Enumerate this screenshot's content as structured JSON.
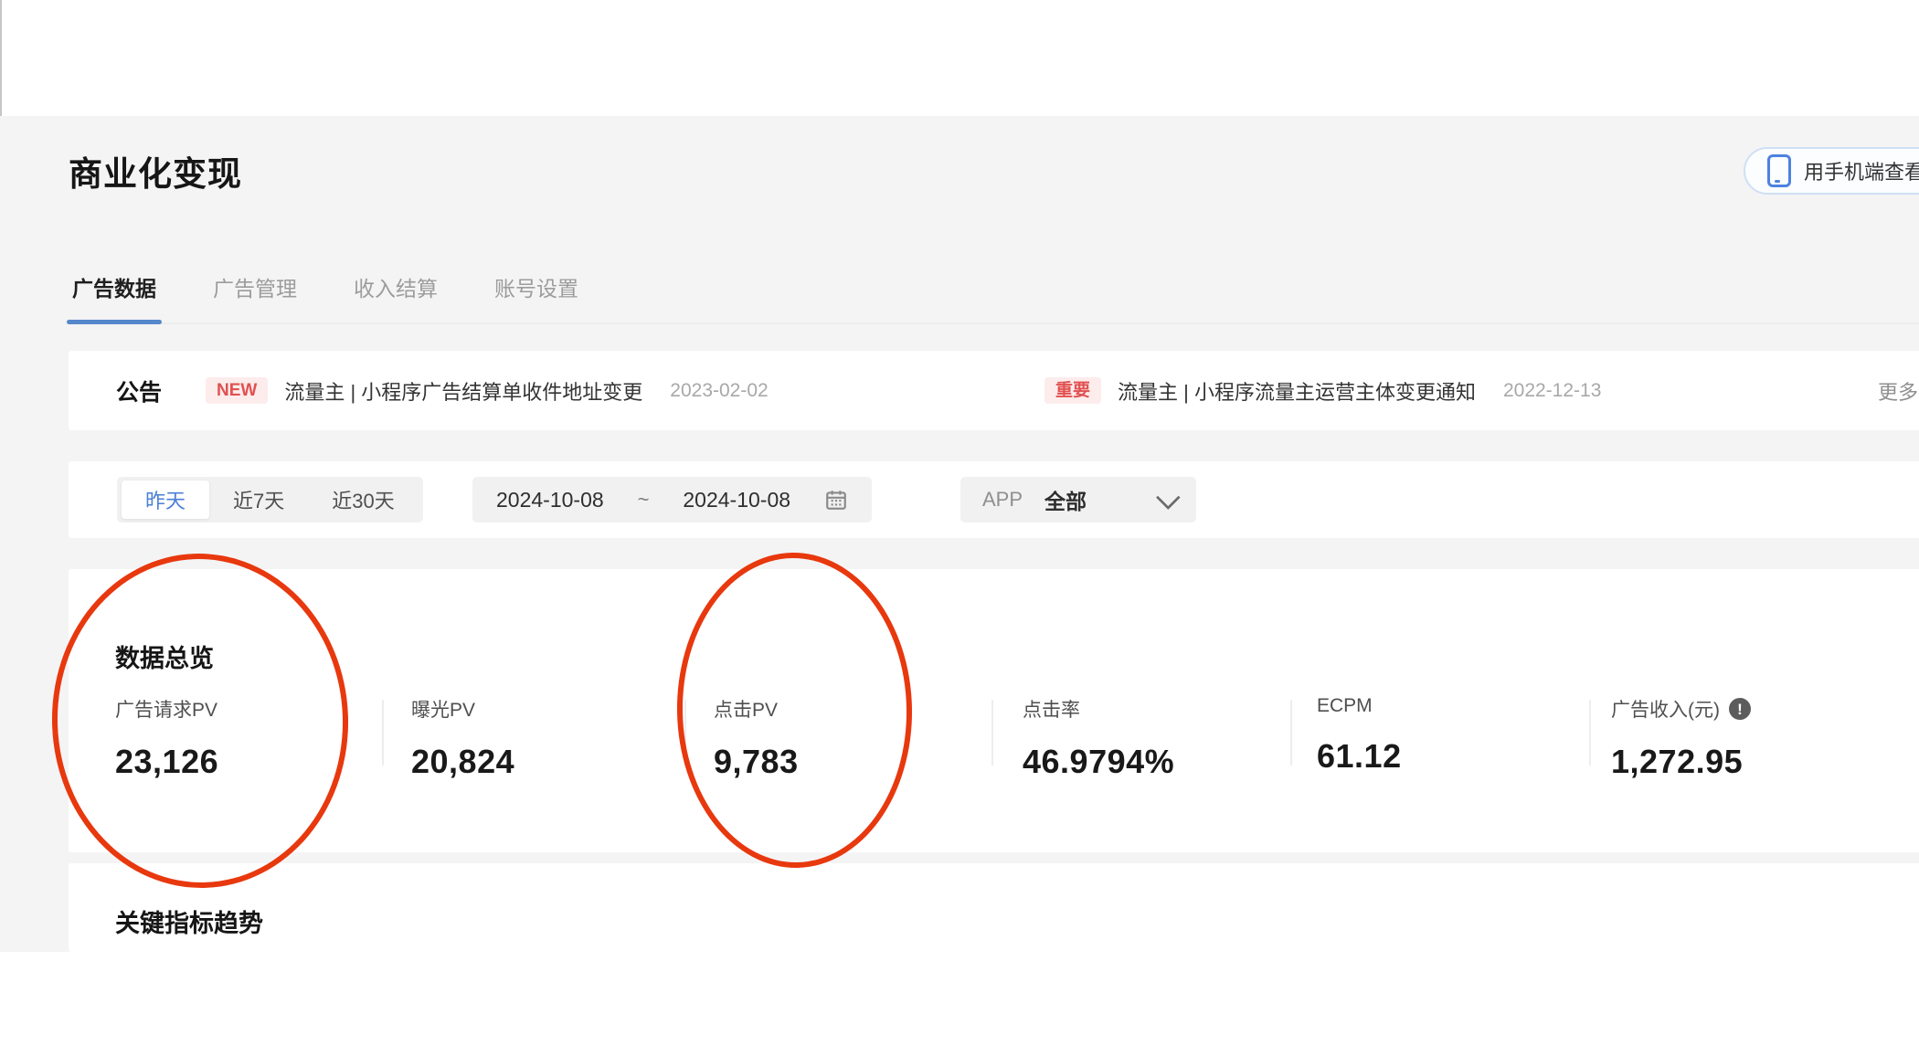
{
  "page": {
    "title": "商业化变现"
  },
  "header": {
    "mobile_button_label": "用手机端查看数据"
  },
  "tabs": [
    {
      "label": "广告数据",
      "active": true
    },
    {
      "label": "广告管理",
      "active": false
    },
    {
      "label": "收入结算",
      "active": false
    },
    {
      "label": "账号设置",
      "active": false
    }
  ],
  "announcement": {
    "label": "公告",
    "items": [
      {
        "badge": "NEW",
        "text": "流量主 | 小程序广告结算单收件地址变更",
        "date": "2023-02-02"
      },
      {
        "badge": "重要",
        "text": "流量主 | 小程序流量主运营主体变更通知",
        "date": "2022-12-13"
      }
    ],
    "more_label": "更多"
  },
  "filters": {
    "quick_ranges": [
      {
        "label": "昨天",
        "active": true
      },
      {
        "label": "近7天",
        "active": false
      },
      {
        "label": "近30天",
        "active": false
      }
    ],
    "date_range": {
      "start": "2024-10-08",
      "separator": "~",
      "end": "2024-10-08"
    },
    "app_select": {
      "label": "APP",
      "value": "全部"
    }
  },
  "overview": {
    "title": "数据总览",
    "metrics": [
      {
        "label": "广告请求PV",
        "value": "23,126"
      },
      {
        "label": "曝光PV",
        "value": "20,824"
      },
      {
        "label": "点击PV",
        "value": "9,783"
      },
      {
        "label": "点击率",
        "value": "46.9794%"
      },
      {
        "label": "ECPM",
        "value": "61.12"
      },
      {
        "label": "广告收入(元)",
        "value": "1,272.95"
      }
    ],
    "info_icon_glyph": "!"
  },
  "trends": {
    "title": "关键指标趋势"
  },
  "colors": {
    "accent_blue": "#5587cb",
    "link_blue": "#4a7fd6",
    "badge_red": "#e15050",
    "badge_bg": "#fdecec",
    "annotation_red": "#e8380e",
    "content_bg": "#f4f4f5"
  }
}
